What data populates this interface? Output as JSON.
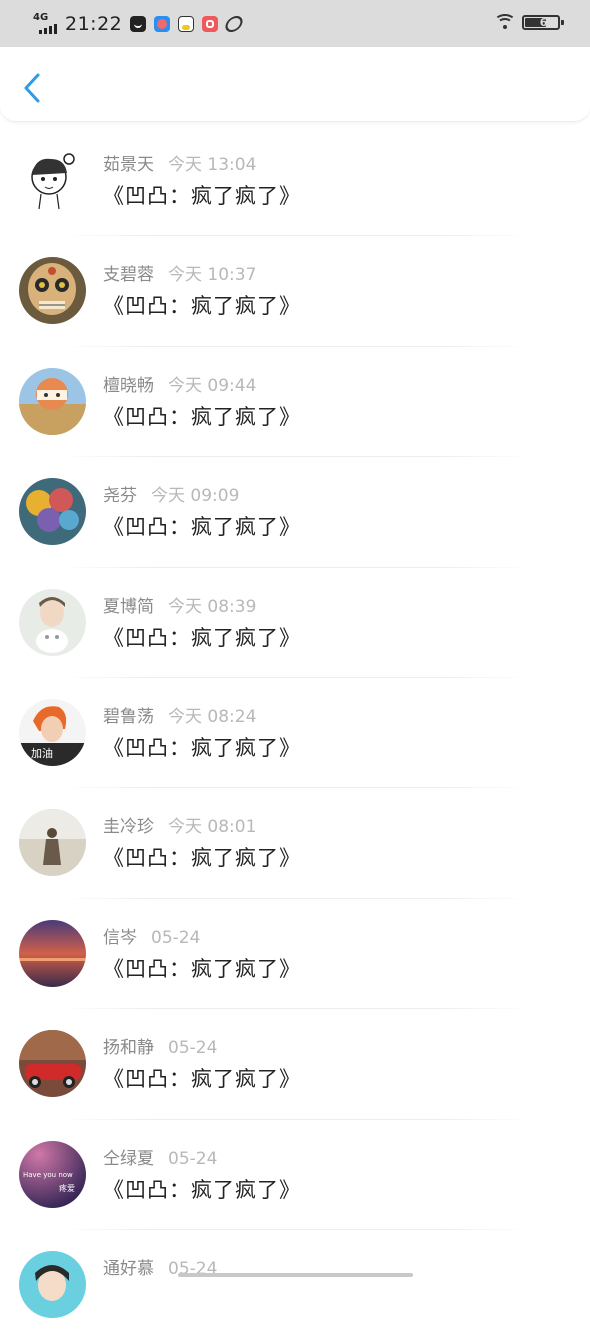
{
  "status_bar": {
    "network": "4G",
    "time": "21:22",
    "battery": "61",
    "battery_level": 0.61
  },
  "nav": {
    "back_icon": "chevron-left-icon",
    "accent_color": "#2f9be6"
  },
  "items": [
    {
      "name": "茹景天",
      "time": "今天 13:04",
      "message": "《凹凸：疯了疯了》"
    },
    {
      "name": "支碧蓉",
      "time": "今天 10:37",
      "message": "《凹凸：疯了疯了》"
    },
    {
      "name": "檀晓畅",
      "time": "今天 09:44",
      "message": "《凹凸：疯了疯了》"
    },
    {
      "name": "尧芬",
      "time": "今天 09:09",
      "message": "《凹凸：疯了疯了》"
    },
    {
      "name": "夏博简",
      "time": "今天 08:39",
      "message": "《凹凸：疯了疯了》"
    },
    {
      "name": "碧鲁荡",
      "time": "今天 08:24",
      "message": "《凹凸：疯了疯了》"
    },
    {
      "name": "圭冷珍",
      "time": "今天 08:01",
      "message": "《凹凸：疯了疯了》"
    },
    {
      "name": "信岑",
      "time": "05-24",
      "message": "《凹凸：疯了疯了》"
    },
    {
      "name": "扬和静",
      "time": "05-24",
      "message": "《凹凸：疯了疯了》"
    },
    {
      "name": "仝绿夏",
      "time": "05-24",
      "message": "《凹凸：疯了疯了》"
    },
    {
      "name": "通好慕",
      "time": "05-24",
      "message": ""
    }
  ]
}
